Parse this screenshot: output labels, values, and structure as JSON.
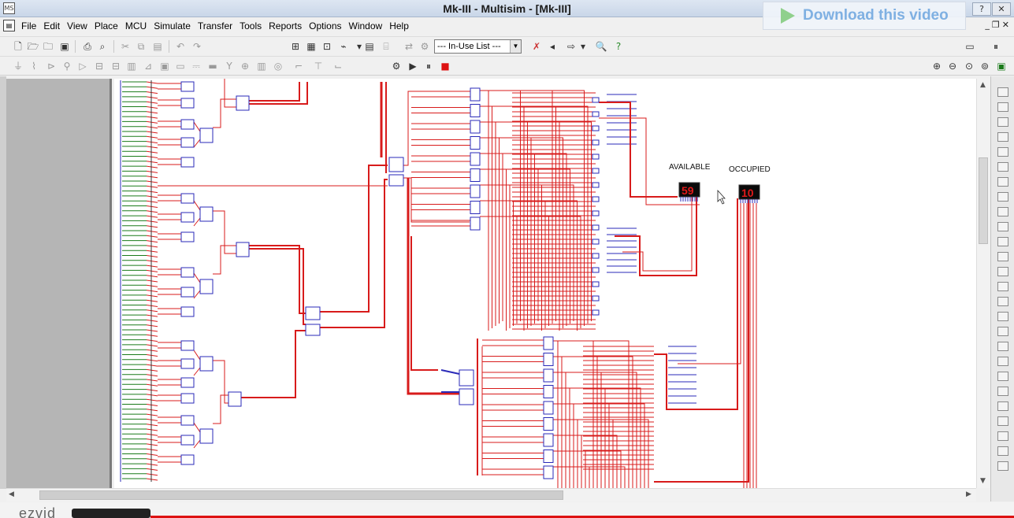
{
  "window": {
    "title": "Mk-III - Multisim - [Mk-III]",
    "app_icon_text": "MS",
    "overlay_banner": "Download this video"
  },
  "menu": {
    "items": [
      "File",
      "Edit",
      "View",
      "Place",
      "MCU",
      "Simulate",
      "Transfer",
      "Tools",
      "Reports",
      "Options",
      "Window",
      "Help"
    ]
  },
  "toolbar": {
    "in_use_list": "--- In-Use List ---"
  },
  "schematic": {
    "labels": {
      "available": "AVAILABLE",
      "occupied": "OCCUPIED"
    },
    "displays": {
      "available_value": "59",
      "occupied_value": "10"
    }
  },
  "colors": {
    "wire": "#d81b1b",
    "component": "#2a2ab8",
    "switch": "#1a7a1a",
    "display_bg": "#0a0a0a",
    "display_segment": "#e01a1a"
  },
  "bottom": {
    "logo_fragment": "ezvid"
  }
}
